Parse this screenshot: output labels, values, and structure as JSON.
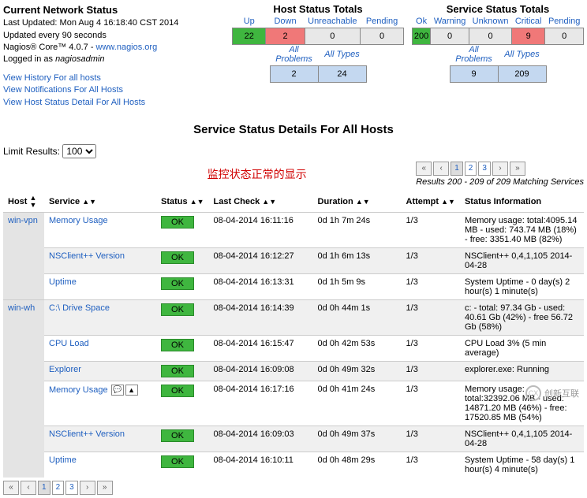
{
  "header": {
    "title": "Current Network Status",
    "last_updated": "Last Updated: Mon Aug 4 16:18:40 CST 2014",
    "update_interval": "Updated every 90 seconds",
    "product": "Nagios® Core™ 4.0.7 - ",
    "product_link": "www.nagios.org",
    "logged_in_prefix": "Logged in as ",
    "logged_in_user": "nagiosadmin",
    "links": {
      "history": "View History For all hosts",
      "notifications": "View Notifications For All Hosts",
      "host_detail": "View Host Status Detail For All Hosts"
    }
  },
  "host_totals": {
    "title": "Host Status Totals",
    "headers": {
      "up": "Up",
      "down": "Down",
      "unreachable": "Unreachable",
      "pending": "Pending"
    },
    "values": {
      "up": "22",
      "down": "2",
      "unreachable": "0",
      "pending": "0"
    },
    "sub_headers": {
      "problems": "All Problems",
      "types": "All Types"
    },
    "sub_values": {
      "problems": "2",
      "types": "24"
    }
  },
  "service_totals": {
    "title": "Service Status Totals",
    "headers": {
      "ok": "Ok",
      "warning": "Warning",
      "unknown": "Unknown",
      "critical": "Critical",
      "pending": "Pending"
    },
    "values": {
      "ok": "200",
      "warning": "0",
      "unknown": "0",
      "critical": "9",
      "pending": "0"
    },
    "sub_headers": {
      "problems": "All Problems",
      "types": "All Types"
    },
    "sub_values": {
      "problems": "9",
      "types": "209"
    }
  },
  "details_title": "Service Status Details For All Hosts",
  "limit": {
    "label": "Limit Results:",
    "value": "100"
  },
  "annotation": "监控状态正常的显示",
  "pager": {
    "pages": [
      "1",
      "2",
      "3"
    ],
    "active": "1",
    "results_text": "Results 200 - 209 of 209 Matching Services"
  },
  "columns": {
    "host": "Host",
    "service": "Service",
    "status": "Status",
    "last_check": "Last Check",
    "duration": "Duration",
    "attempt": "Attempt",
    "info": "Status Information"
  },
  "status_label": {
    "ok": "OK"
  },
  "rows": [
    {
      "host": "win-vpn",
      "services": [
        {
          "name": "Memory Usage",
          "status": "ok",
          "last_check": "08-04-2014 16:11:16",
          "duration": "0d 1h 7m 24s",
          "attempt": "1/3",
          "info": "Memory usage: total:4095.14 MB - used: 743.74 MB (18%) - free: 3351.40 MB (82%)"
        },
        {
          "name": "NSClient++ Version",
          "status": "ok",
          "last_check": "08-04-2014 16:12:27",
          "duration": "0d 1h 6m 13s",
          "attempt": "1/3",
          "info": "NSClient++ 0,4,1,105 2014-04-28"
        },
        {
          "name": "Uptime",
          "status": "ok",
          "last_check": "08-04-2014 16:13:31",
          "duration": "0d 1h 5m 9s",
          "attempt": "1/3",
          "info": "System Uptime - 0 day(s) 2 hour(s) 1 minute(s)"
        }
      ]
    },
    {
      "host": "win-wh",
      "services": [
        {
          "name": "C:\\ Drive Space",
          "status": "ok",
          "last_check": "08-04-2014 16:14:39",
          "duration": "0d 0h 44m 1s",
          "attempt": "1/3",
          "info": "c: - total: 97.34 Gb - used: 40.61 Gb (42%) - free 56.72 Gb (58%)"
        },
        {
          "name": "CPU Load",
          "status": "ok",
          "last_check": "08-04-2014 16:15:47",
          "duration": "0d 0h 42m 53s",
          "attempt": "1/3",
          "info": "CPU Load 3% (5 min average)"
        },
        {
          "name": "Explorer",
          "status": "ok",
          "last_check": "08-04-2014 16:09:08",
          "duration": "0d 0h 49m 32s",
          "attempt": "1/3",
          "info": "explorer.exe: Running"
        },
        {
          "name": "Memory Usage",
          "icons": true,
          "status": "ok",
          "last_check": "08-04-2014 16:17:16",
          "duration": "0d 0h 41m 24s",
          "attempt": "1/3",
          "info": "Memory usage: total:32392.06 MB - used: 14871.20 MB (46%) - free: 17520.85 MB (54%)"
        },
        {
          "name": "NSClient++ Version",
          "status": "ok",
          "last_check": "08-04-2014 16:09:03",
          "duration": "0d 0h 49m 37s",
          "attempt": "1/3",
          "info": "NSClient++ 0,4,1,105 2014-04-28"
        },
        {
          "name": "Uptime",
          "status": "ok",
          "last_check": "08-04-2014 16:10:11",
          "duration": "0d 0h 48m 29s",
          "attempt": "1/3",
          "info": "System Uptime - 58 day(s) 1 hour(s) 4 minute(s)"
        }
      ]
    }
  ],
  "watermark": "创新互联"
}
